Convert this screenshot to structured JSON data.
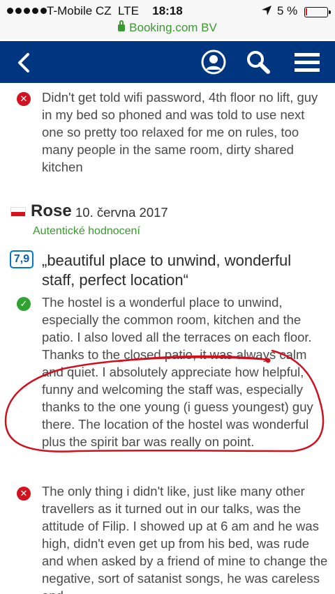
{
  "status_bar": {
    "carrier": "T-Mobile CZ",
    "network": "LTE",
    "time": "18:18",
    "battery": "5 %",
    "battery_level": 0.05,
    "url": "Booking.com BV",
    "icons": [
      "signal-dots",
      "location-arrow-icon",
      "battery-icon",
      "lock-icon"
    ]
  },
  "app_header": {
    "background": "#003580",
    "icons": [
      "back-chevron-icon",
      "profile-icon",
      "search-icon",
      "menu-icon"
    ]
  },
  "previous_review": {
    "negative": "Didn't get told wifi password, 4th floor no lift, guy in my bed so phoned and was told to use next one so pretty too relaxed for me on rules, too many people in the same room, dirty shared kitchen"
  },
  "review": {
    "reviewer": "Rose",
    "date": "10. června 2017",
    "verified": "Autentické hodnocení",
    "score": "7,9",
    "title": "„beautiful place to unwind, wonderful staff, perfect location“",
    "positive": "The hostel is a wonderful place to unwind, especially the common room, kitchen and the patio. I also loved all the terraces on each floor. Thanks to the closed patio, it was always calm and quiet. I absolutely appreciate how helpful, funny and welcoming the staff was, especially thanks to the one young (i guess youngest) guy there. The location of the hostel was wonderful plus the spirit bar was really on point.",
    "negative": "The only thing i didn't like, just like many other travellers as it turned out in our talks, was the attitude of Filip. I showed up at 6 am and he was high, didn't even get up from his bed, was rude and when asked by a friend of mine to change the negative, sort of satanist songs, he was careless and"
  },
  "colors": {
    "positive_icon": "#2fa32f",
    "negative_icon": "#d4111e",
    "verified_text": "#3a9a2f",
    "score_border": "#0077cc",
    "annotation_red": "#d0101e"
  }
}
